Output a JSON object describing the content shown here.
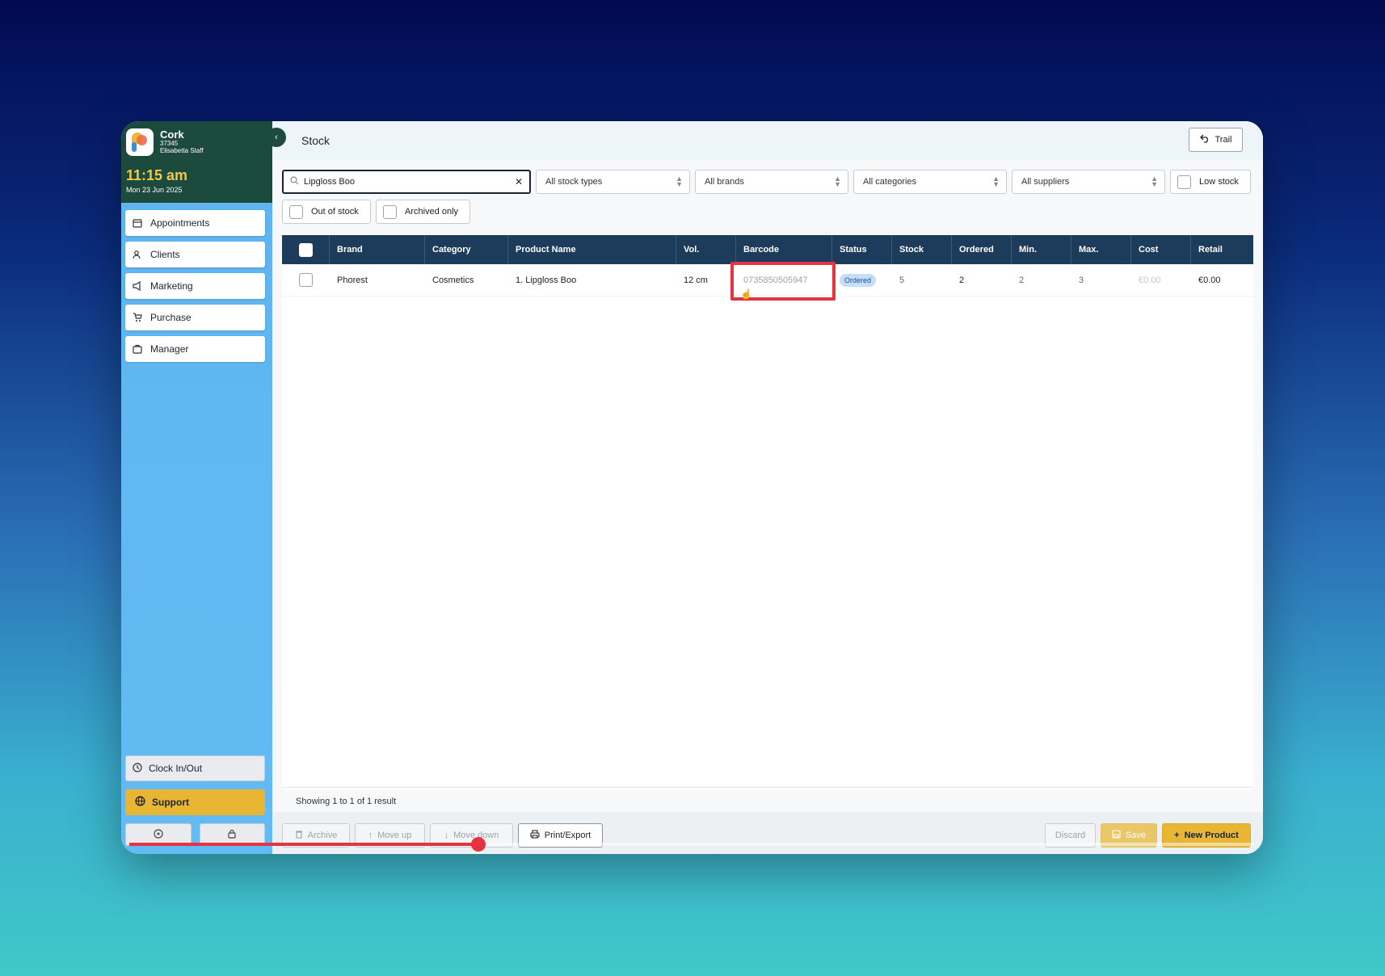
{
  "sidebar": {
    "location_name": "Cork",
    "location_id": "37345",
    "staff": "Elisabetta Staff",
    "time": "11:15 am",
    "date": "Mon 23 Jun 2025",
    "items": [
      {
        "label": "Appointments",
        "icon": "calendar-icon"
      },
      {
        "label": "Clients",
        "icon": "users-icon"
      },
      {
        "label": "Marketing",
        "icon": "megaphone-icon"
      },
      {
        "label": "Purchase",
        "icon": "cart-icon"
      },
      {
        "label": "Manager",
        "icon": "briefcase-icon"
      }
    ],
    "clock_in_out": "Clock In/Out",
    "support": "Support"
  },
  "header": {
    "title": "Stock",
    "trail_label": "Trail"
  },
  "filters": {
    "search_value": "Lipgloss Boo",
    "stock_types": "All stock types",
    "brands": "All brands",
    "categories": "All categories",
    "suppliers": "All suppliers",
    "low_stock": "Low stock",
    "out_of_stock": "Out of stock",
    "archived_only": "Archived only"
  },
  "table": {
    "columns": [
      "Brand",
      "Category",
      "Product Name",
      "Vol.",
      "Barcode",
      "Status",
      "Stock",
      "Ordered",
      "Min.",
      "Max.",
      "Cost",
      "Retail"
    ],
    "rows": [
      {
        "brand": "Phorest",
        "category": "Cosmetics",
        "product_name": "1. Lipgloss Boo",
        "vol": "12 cm",
        "barcode": "0735850505947",
        "status": "Ordered",
        "stock": "5",
        "ordered": "2",
        "min": "2",
        "max": "3",
        "cost": "€0.00",
        "retail": "€0.00"
      }
    ]
  },
  "footer": {
    "results_text": "Showing 1 to 1 of 1 result"
  },
  "actions": {
    "archive": "Archive",
    "move_up": "Move up",
    "move_down": "Move down",
    "print_export": "Print/Export",
    "discard": "Discard",
    "save": "Save",
    "new_product": "New Product"
  },
  "colors": {
    "sidebar_top": "#1c4a3c",
    "sidebar": "#5fb4f0",
    "table_header": "#1d3c5c",
    "accent_gold": "#e8b632",
    "highlight_red": "#e53340"
  },
  "video": {
    "progress": 0.31
  }
}
